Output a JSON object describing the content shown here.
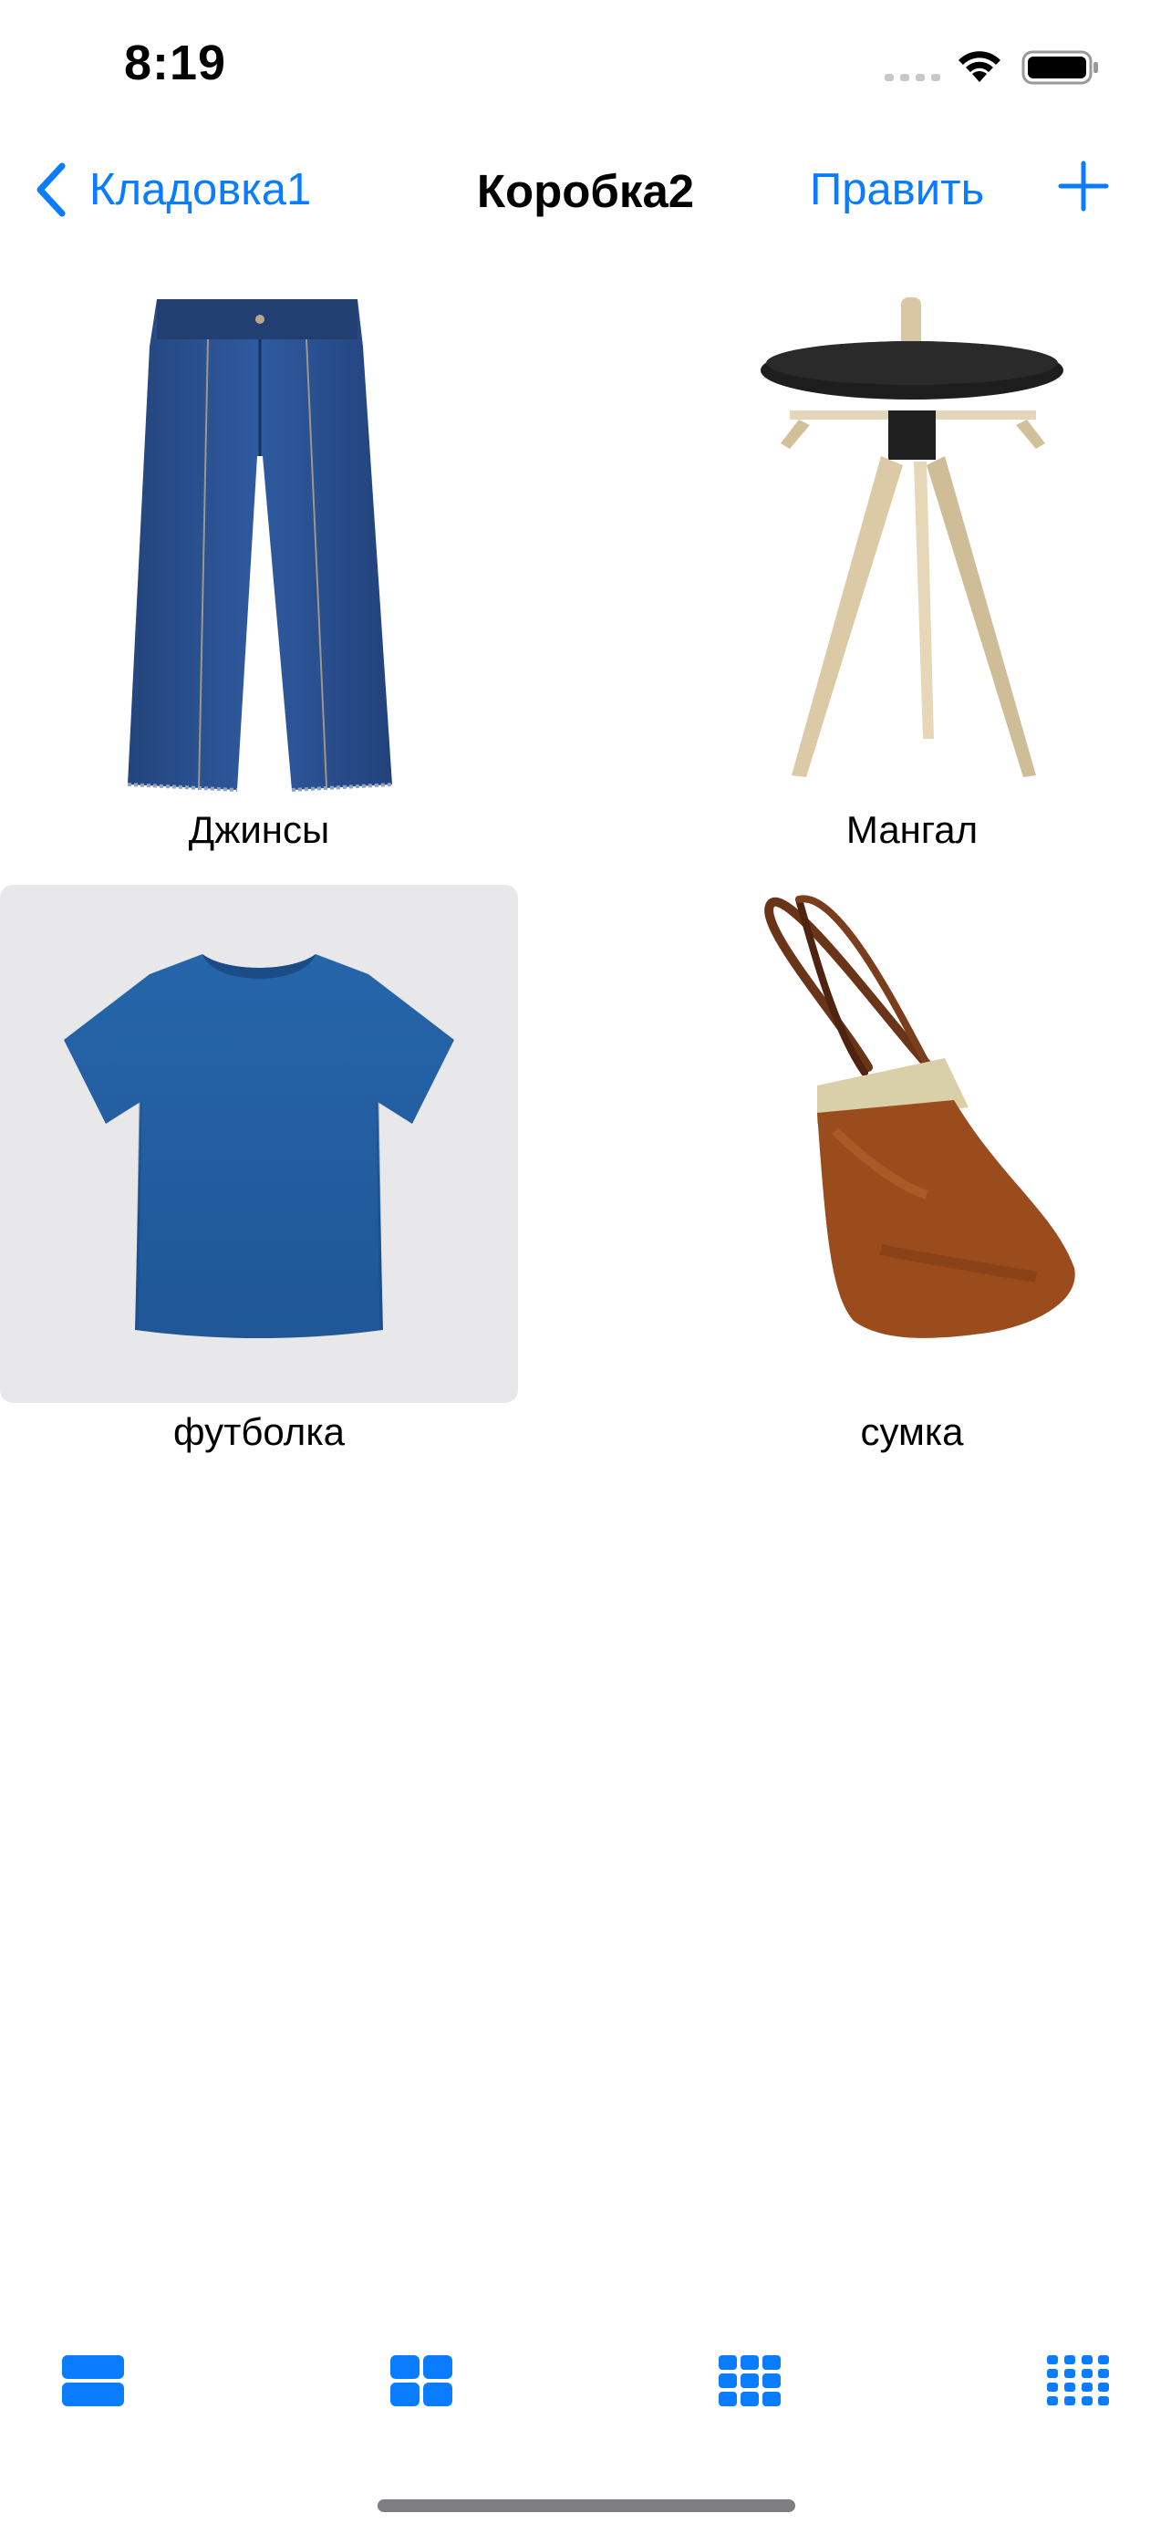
{
  "status_bar": {
    "time": "8:19"
  },
  "nav": {
    "back_label": "Кладовка1",
    "title": "Коробка2",
    "edit_label": "Править"
  },
  "items": [
    {
      "label": "Джинсы",
      "image": "jeans",
      "selected": false
    },
    {
      "label": "Мангал",
      "image": "side-table",
      "selected": false
    },
    {
      "label": "футболка",
      "image": "t-shirt",
      "selected": true
    },
    {
      "label": "сумка",
      "image": "handbag",
      "selected": false
    }
  ],
  "toolbar": {
    "buttons": [
      "layout-1-column-icon",
      "layout-2-columns-icon",
      "layout-3-columns-icon",
      "layout-4-columns-icon"
    ]
  },
  "colors": {
    "accent": "#0a7cff",
    "selected_bg": "#e8e8ea"
  }
}
